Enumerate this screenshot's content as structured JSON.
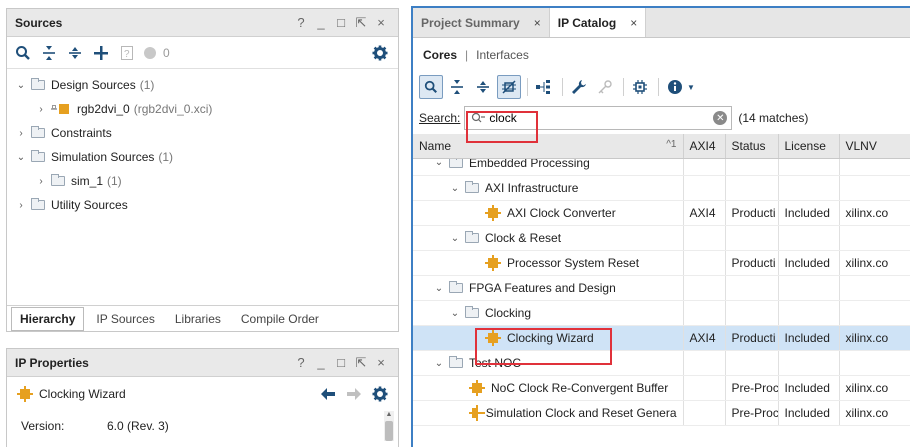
{
  "sources_panel": {
    "title": "Sources",
    "header_controls": [
      "?",
      "_",
      "□",
      "⇱",
      "×"
    ],
    "toolbar": {
      "count": "0"
    },
    "tree": [
      {
        "label": "Design Sources",
        "count": "(1)",
        "expanded": true
      },
      {
        "label": "rgb2dvi_0",
        "meta": "(rgb2dvi_0.xci)"
      },
      {
        "label": "Constraints"
      },
      {
        "label": "Simulation Sources",
        "count": "(1)",
        "expanded": true
      },
      {
        "label": "sim_1",
        "count": "(1)"
      },
      {
        "label": "Utility Sources"
      }
    ],
    "tabs": [
      "Hierarchy",
      "IP Sources",
      "Libraries",
      "Compile Order"
    ]
  },
  "ip_properties": {
    "title": "IP Properties",
    "header_controls": [
      "?",
      "_",
      "□",
      "⇱",
      "×"
    ],
    "selected_name": "Clocking Wizard",
    "version_label": "Version:",
    "version_value": "6.0 (Rev. 3)"
  },
  "main": {
    "tabs": [
      {
        "label": "Project Summary",
        "close": "×"
      },
      {
        "label": "IP Catalog",
        "close": "×",
        "active": true
      }
    ],
    "subtabs": [
      "Cores",
      "|",
      "Interfaces"
    ],
    "search": {
      "label": "Search:",
      "value": "clock",
      "matches": "(14 matches)"
    },
    "columns": [
      "Name",
      "AXI4",
      "Status",
      "License",
      "VLNV"
    ],
    "sort_indicator": "^1",
    "rows": [
      {
        "name": "Embedded Processing",
        "axi4": "",
        "status": "",
        "license": "",
        "vlnv": ""
      },
      {
        "name": "AXI Infrastructure",
        "axi4": "",
        "status": "",
        "license": "",
        "vlnv": ""
      },
      {
        "name": "AXI Clock Converter",
        "axi4": "AXI4",
        "status": "Producti",
        "license": "Included",
        "vlnv": "xilinx.co"
      },
      {
        "name": "Clock & Reset",
        "axi4": "",
        "status": "",
        "license": "",
        "vlnv": ""
      },
      {
        "name": "Processor System Reset",
        "axi4": "",
        "status": "Producti",
        "license": "Included",
        "vlnv": "xilinx.co"
      },
      {
        "name": "FPGA Features and Design",
        "axi4": "",
        "status": "",
        "license": "",
        "vlnv": ""
      },
      {
        "name": "Clocking",
        "axi4": "",
        "status": "",
        "license": "",
        "vlnv": ""
      },
      {
        "name": "Clocking Wizard",
        "axi4": "AXI4",
        "status": "Producti",
        "license": "Included",
        "vlnv": "xilinx.co"
      },
      {
        "name": "Test NOC",
        "axi4": "",
        "status": "",
        "license": "",
        "vlnv": ""
      },
      {
        "name": "NoC Clock Re-Convergent Buffer",
        "axi4": "",
        "status": "Pre-Proc",
        "license": "Included",
        "vlnv": "xilinx.co"
      },
      {
        "name": "Simulation Clock and Reset Genera",
        "axi4": "",
        "status": "Pre-Proc",
        "license": "Included",
        "vlnv": "xilinx.co"
      }
    ]
  },
  "colors": {
    "highlight": "#e0313a",
    "selected_row": "#cfe3f6",
    "accent_border": "#3d7fc4"
  }
}
